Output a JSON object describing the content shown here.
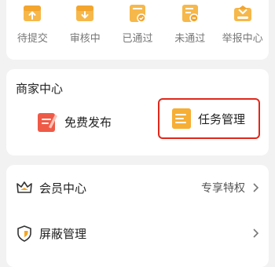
{
  "status_items": [
    {
      "label": "待提交",
      "icon": "upload-box-icon"
    },
    {
      "label": "审核中",
      "icon": "download-box-icon"
    },
    {
      "label": "已通过",
      "icon": "approved-doc-icon"
    },
    {
      "label": "未通过",
      "icon": "rejected-doc-icon"
    },
    {
      "label": "举报中心",
      "icon": "report-box-icon"
    }
  ],
  "merchant": {
    "title": "商家中心",
    "publish_label": "免费发布",
    "task_label": "任务管理"
  },
  "list": {
    "member_label": "会员中心",
    "member_right": "专享特权",
    "block_label": "屏蔽管理"
  },
  "colors": {
    "accent": "#f5a623",
    "highlight": "#e0281b",
    "publish": "#ef5a47"
  }
}
